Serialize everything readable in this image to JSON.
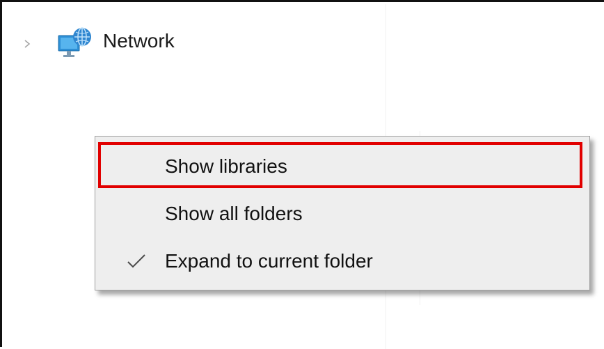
{
  "navigation": {
    "expand_icon": "chevron-right-icon",
    "icon": "network-icon",
    "label": "Network"
  },
  "context_menu": {
    "items": [
      {
        "label": "Show libraries",
        "checked": false,
        "highlighted": true
      },
      {
        "label": "Show all folders",
        "checked": false,
        "highlighted": false
      },
      {
        "label": "Expand to current folder",
        "checked": true,
        "highlighted": false
      }
    ],
    "highlight_color": "#e10000",
    "background_color": "#eeeeee"
  }
}
